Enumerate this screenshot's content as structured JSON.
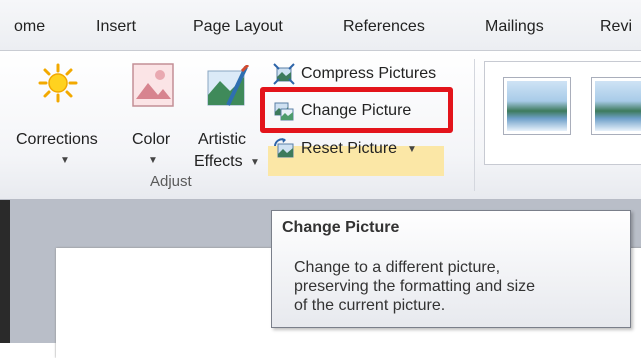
{
  "tabs": [
    "ome",
    "Insert",
    "Page Layout",
    "References",
    "Mailings",
    "Revi"
  ],
  "adjust_group": {
    "label": "Adjust",
    "corrections_label": "Corrections",
    "color_label": "Color",
    "artistic_line1": "Artistic",
    "artistic_line2": "Effects",
    "compress_label": "Compress Pictures",
    "change_label": "Change Picture",
    "reset_label": "Reset Picture"
  },
  "tooltip": {
    "title": "Change Picture",
    "lines": [
      "Change to a different picture,",
      "preserving the formatting and size",
      "of the current picture."
    ]
  },
  "colors": {
    "highlight": "#e3141b",
    "hover": "#fbe7a6"
  }
}
